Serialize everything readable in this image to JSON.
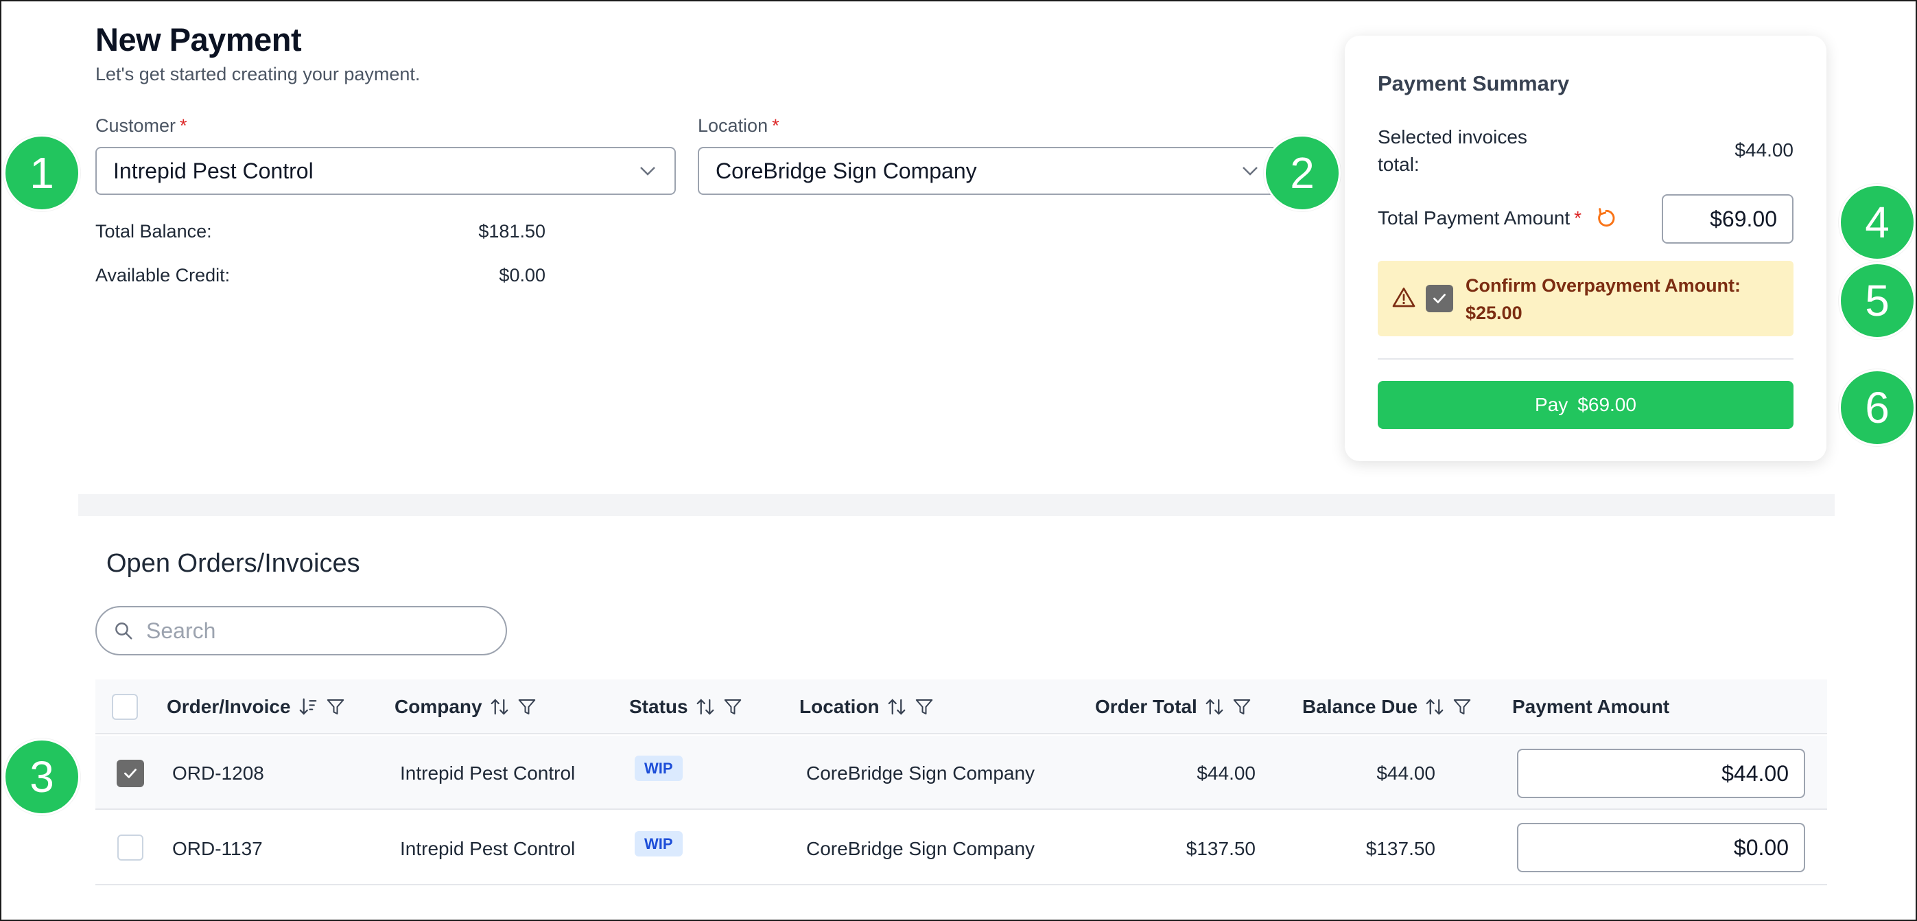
{
  "header": {
    "title": "New Payment",
    "subtitle": "Let's get started creating your payment."
  },
  "customer": {
    "label": "Customer",
    "required_mark": "*",
    "value": "Intrepid Pest Control",
    "total_balance_label": "Total Balance:",
    "total_balance_value": "$181.50",
    "available_credit_label": "Available Credit:",
    "available_credit_value": "$0.00"
  },
  "location": {
    "label": "Location",
    "required_mark": "*",
    "value": "CoreBridge Sign Company"
  },
  "summary": {
    "title": "Payment Summary",
    "selected_label_line1": "Selected invoices",
    "selected_label_line2": "total:",
    "selected_value": "$44.00",
    "total_payment_label": "Total Payment Amount",
    "required_mark": "*",
    "total_payment_value": "$69.00",
    "overpay_line1": "Confirm Overpayment Amount:",
    "overpay_line2": "$25.00",
    "overpay_checked": true,
    "pay_label": "Pay",
    "pay_amount": "$69.00"
  },
  "orders": {
    "title": "Open Orders/Invoices",
    "search_placeholder": "Search",
    "columns": [
      "Order/Invoice",
      "Company",
      "Status",
      "Location",
      "Order Total",
      "Balance Due",
      "Payment Amount"
    ],
    "rows": [
      {
        "checked": true,
        "order": "ORD-1208",
        "company": "Intrepid Pest Control",
        "status": "WIP",
        "location": "CoreBridge Sign Company",
        "order_total": "$44.00",
        "balance_due": "$44.00",
        "payment_amount": "$44.00"
      },
      {
        "checked": false,
        "order": "ORD-1137",
        "company": "Intrepid Pest Control",
        "status": "WIP",
        "location": "CoreBridge Sign Company",
        "order_total": "$137.50",
        "balance_due": "$137.50",
        "payment_amount": "$0.00"
      }
    ]
  },
  "callouts": [
    "1",
    "2",
    "3",
    "4",
    "5",
    "6"
  ],
  "colors": {
    "accent_green": "#22c55e",
    "required_red": "#dc2626",
    "warning_bg": "#fdf2c4",
    "warning_text": "#7c2d12",
    "badge_bg": "#dbeafe",
    "badge_text": "#1d4ed8",
    "reset_icon_orange": "#f97316"
  }
}
